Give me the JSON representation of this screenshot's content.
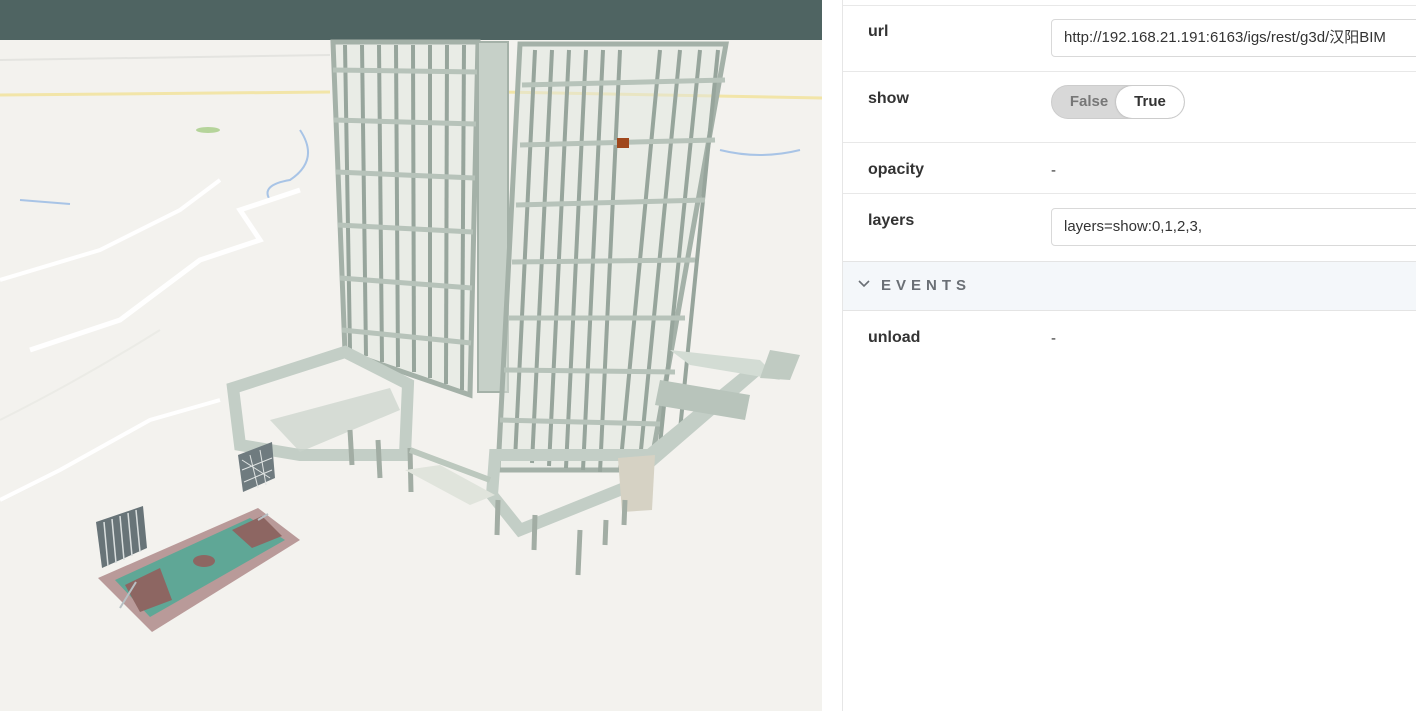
{
  "viewer": {
    "description_icon": "bim-building-model"
  },
  "properties": {
    "url": {
      "label": "url",
      "value": "http://192.168.21.191:6163/igs/rest/g3d/汉阳BIM"
    },
    "show": {
      "label": "show",
      "option_false": "False",
      "option_true": "True",
      "selected": "True"
    },
    "opacity": {
      "label": "opacity",
      "value": "-"
    },
    "layers": {
      "label": "layers",
      "value": "layers=show:0,1,2,3,"
    }
  },
  "events": {
    "title": "EVENTS",
    "unload": {
      "label": "unload",
      "value": "-"
    }
  },
  "colors": {
    "sky": "#4f6462",
    "ground": "#f3f2ee",
    "building": "#b9c6bd",
    "court": "#5fa796",
    "panel_header": "#f4f7fa"
  }
}
